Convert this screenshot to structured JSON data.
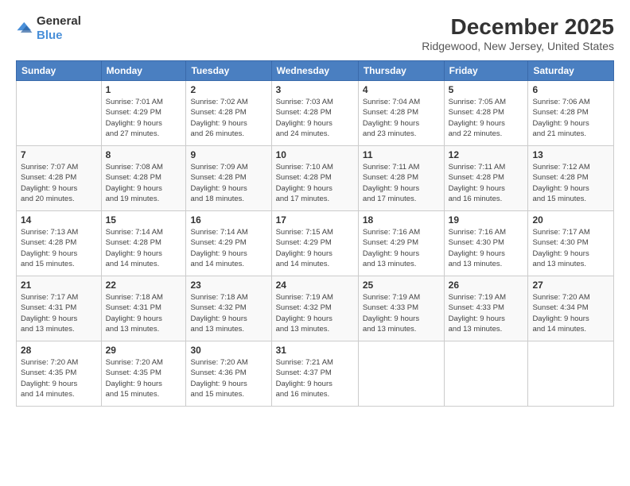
{
  "logo": {
    "general": "General",
    "blue": "Blue"
  },
  "title": "December 2025",
  "location": "Ridgewood, New Jersey, United States",
  "weekdays": [
    "Sunday",
    "Monday",
    "Tuesday",
    "Wednesday",
    "Thursday",
    "Friday",
    "Saturday"
  ],
  "weeks": [
    [
      {
        "day": "",
        "info": ""
      },
      {
        "day": "1",
        "info": "Sunrise: 7:01 AM\nSunset: 4:29 PM\nDaylight: 9 hours\nand 27 minutes."
      },
      {
        "day": "2",
        "info": "Sunrise: 7:02 AM\nSunset: 4:28 PM\nDaylight: 9 hours\nand 26 minutes."
      },
      {
        "day": "3",
        "info": "Sunrise: 7:03 AM\nSunset: 4:28 PM\nDaylight: 9 hours\nand 24 minutes."
      },
      {
        "day": "4",
        "info": "Sunrise: 7:04 AM\nSunset: 4:28 PM\nDaylight: 9 hours\nand 23 minutes."
      },
      {
        "day": "5",
        "info": "Sunrise: 7:05 AM\nSunset: 4:28 PM\nDaylight: 9 hours\nand 22 minutes."
      },
      {
        "day": "6",
        "info": "Sunrise: 7:06 AM\nSunset: 4:28 PM\nDaylight: 9 hours\nand 21 minutes."
      }
    ],
    [
      {
        "day": "7",
        "info": "Sunrise: 7:07 AM\nSunset: 4:28 PM\nDaylight: 9 hours\nand 20 minutes."
      },
      {
        "day": "8",
        "info": "Sunrise: 7:08 AM\nSunset: 4:28 PM\nDaylight: 9 hours\nand 19 minutes."
      },
      {
        "day": "9",
        "info": "Sunrise: 7:09 AM\nSunset: 4:28 PM\nDaylight: 9 hours\nand 18 minutes."
      },
      {
        "day": "10",
        "info": "Sunrise: 7:10 AM\nSunset: 4:28 PM\nDaylight: 9 hours\nand 17 minutes."
      },
      {
        "day": "11",
        "info": "Sunrise: 7:11 AM\nSunset: 4:28 PM\nDaylight: 9 hours\nand 17 minutes."
      },
      {
        "day": "12",
        "info": "Sunrise: 7:11 AM\nSunset: 4:28 PM\nDaylight: 9 hours\nand 16 minutes."
      },
      {
        "day": "13",
        "info": "Sunrise: 7:12 AM\nSunset: 4:28 PM\nDaylight: 9 hours\nand 15 minutes."
      }
    ],
    [
      {
        "day": "14",
        "info": "Sunrise: 7:13 AM\nSunset: 4:28 PM\nDaylight: 9 hours\nand 15 minutes."
      },
      {
        "day": "15",
        "info": "Sunrise: 7:14 AM\nSunset: 4:28 PM\nDaylight: 9 hours\nand 14 minutes."
      },
      {
        "day": "16",
        "info": "Sunrise: 7:14 AM\nSunset: 4:29 PM\nDaylight: 9 hours\nand 14 minutes."
      },
      {
        "day": "17",
        "info": "Sunrise: 7:15 AM\nSunset: 4:29 PM\nDaylight: 9 hours\nand 14 minutes."
      },
      {
        "day": "18",
        "info": "Sunrise: 7:16 AM\nSunset: 4:29 PM\nDaylight: 9 hours\nand 13 minutes."
      },
      {
        "day": "19",
        "info": "Sunrise: 7:16 AM\nSunset: 4:30 PM\nDaylight: 9 hours\nand 13 minutes."
      },
      {
        "day": "20",
        "info": "Sunrise: 7:17 AM\nSunset: 4:30 PM\nDaylight: 9 hours\nand 13 minutes."
      }
    ],
    [
      {
        "day": "21",
        "info": "Sunrise: 7:17 AM\nSunset: 4:31 PM\nDaylight: 9 hours\nand 13 minutes."
      },
      {
        "day": "22",
        "info": "Sunrise: 7:18 AM\nSunset: 4:31 PM\nDaylight: 9 hours\nand 13 minutes."
      },
      {
        "day": "23",
        "info": "Sunrise: 7:18 AM\nSunset: 4:32 PM\nDaylight: 9 hours\nand 13 minutes."
      },
      {
        "day": "24",
        "info": "Sunrise: 7:19 AM\nSunset: 4:32 PM\nDaylight: 9 hours\nand 13 minutes."
      },
      {
        "day": "25",
        "info": "Sunrise: 7:19 AM\nSunset: 4:33 PM\nDaylight: 9 hours\nand 13 minutes."
      },
      {
        "day": "26",
        "info": "Sunrise: 7:19 AM\nSunset: 4:33 PM\nDaylight: 9 hours\nand 13 minutes."
      },
      {
        "day": "27",
        "info": "Sunrise: 7:20 AM\nSunset: 4:34 PM\nDaylight: 9 hours\nand 14 minutes."
      }
    ],
    [
      {
        "day": "28",
        "info": "Sunrise: 7:20 AM\nSunset: 4:35 PM\nDaylight: 9 hours\nand 14 minutes."
      },
      {
        "day": "29",
        "info": "Sunrise: 7:20 AM\nSunset: 4:35 PM\nDaylight: 9 hours\nand 15 minutes."
      },
      {
        "day": "30",
        "info": "Sunrise: 7:20 AM\nSunset: 4:36 PM\nDaylight: 9 hours\nand 15 minutes."
      },
      {
        "day": "31",
        "info": "Sunrise: 7:21 AM\nSunset: 4:37 PM\nDaylight: 9 hours\nand 16 minutes."
      },
      {
        "day": "",
        "info": ""
      },
      {
        "day": "",
        "info": ""
      },
      {
        "day": "",
        "info": ""
      }
    ]
  ]
}
